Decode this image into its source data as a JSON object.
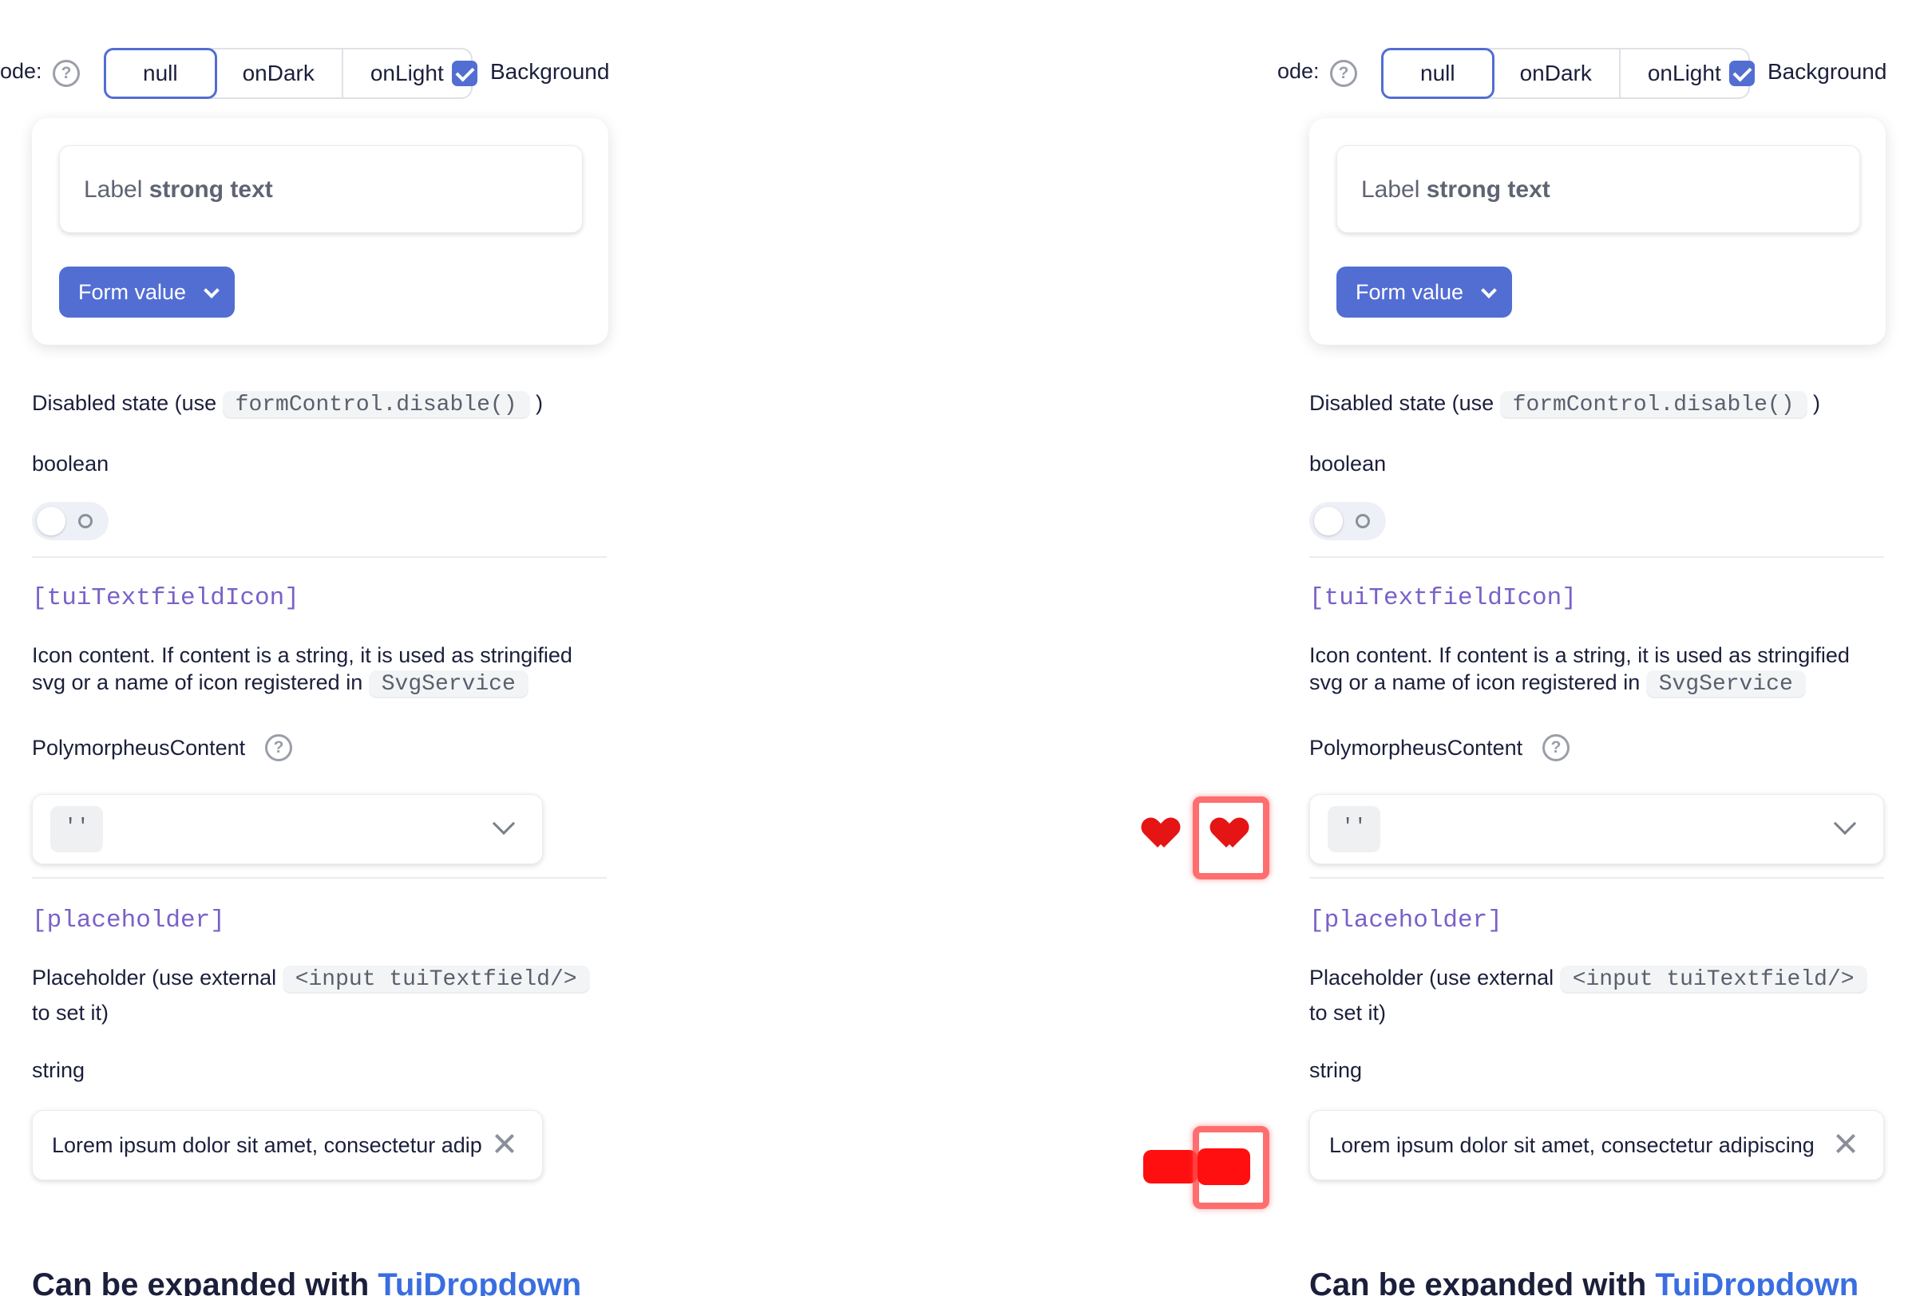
{
  "mode": {
    "label": "lode:",
    "help_icon": "question-circle-icon",
    "options": [
      "null",
      "onDark",
      "onLight"
    ],
    "selected": "null",
    "background_label": "Background",
    "background_checked": true
  },
  "demo": {
    "field_label_plain": "Label",
    "field_label_strong": "strong text",
    "button_label": "Form value",
    "button_icon": "chevron-down-icon"
  },
  "disabled": {
    "text": "Disabled state (use",
    "code": "formControl.disable()",
    "close_paren": ")",
    "type": "boolean",
    "toggle_on": false
  },
  "icon_prop": {
    "name": "[tuiTextfieldIcon]",
    "desc_line1": "Icon content. If content is a string, it is used as stringified",
    "desc_line2": "svg or a name of icon registered in",
    "code": "SvgService",
    "type": "PolymorpheusContent",
    "select_value": "''"
  },
  "placeholder_prop": {
    "name": "[placeholder]",
    "desc_prefix": "Placeholder (use external",
    "code": "<input tuiTextfield/>",
    "desc_suffix": "to set it)",
    "type": "string",
    "value_left": "Lorem ipsum dolor sit amet, consectetur adip",
    "value_right": "Lorem ipsum dolor sit amet, consectetur adipiscing"
  },
  "heading": {
    "prefix": "Can be expanded with",
    "link": "TuiDropdown"
  },
  "colors": {
    "accent": "#526ed3",
    "prop_name": "#7a61c7",
    "link": "#3a6ee0",
    "artifact": "#e51515"
  }
}
